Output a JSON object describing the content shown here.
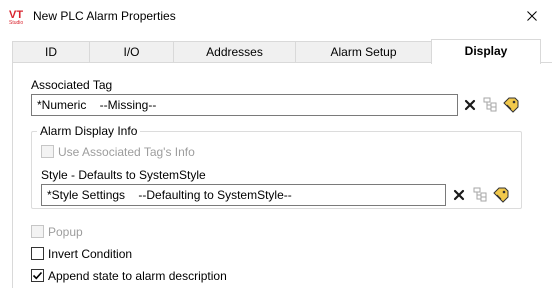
{
  "window": {
    "title": "New PLC Alarm Properties",
    "logo_text": "VT",
    "logo_subtext": "Studio"
  },
  "tabs": [
    {
      "label": "ID"
    },
    {
      "label": "I/O"
    },
    {
      "label": "Addresses"
    },
    {
      "label": "Alarm Setup"
    },
    {
      "label": "Display",
      "active": true
    }
  ],
  "associated_tag": {
    "label": "Associated Tag",
    "value": "*Numeric    --Missing--"
  },
  "alarm_display_info": {
    "legend": "Alarm Display Info",
    "use_associated_tag_label": "Use Associated Tag's Info",
    "use_associated_tag_checked": false,
    "style_label": "Style - Defaults to SystemStyle",
    "style_value": "*Style Settings    --Defaulting to SystemStyle--"
  },
  "options": {
    "popup_label": "Popup",
    "popup_checked": false,
    "invert_label": "Invert Condition",
    "invert_checked": false,
    "append_label": "Append state to alarm description",
    "append_checked": true
  },
  "colors": {
    "logo_red": "#d9232d",
    "accent_yellow": "#e8b400"
  }
}
